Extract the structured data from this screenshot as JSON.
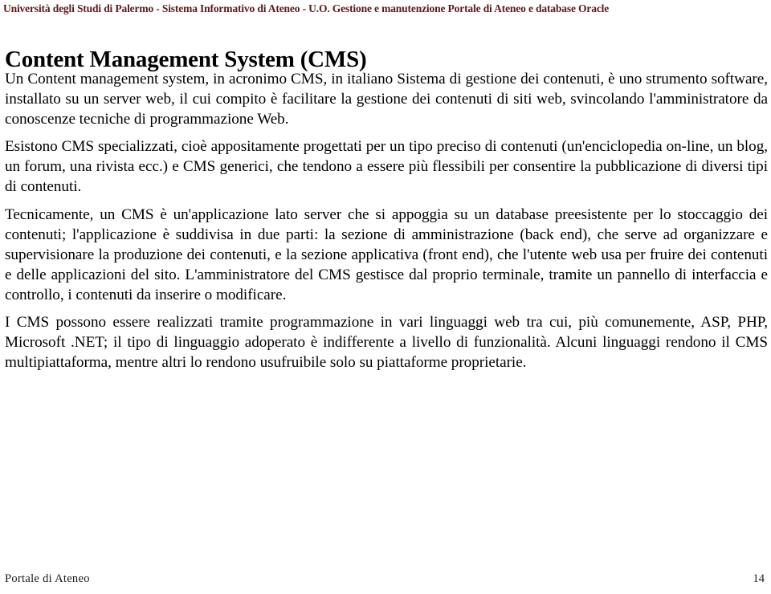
{
  "header": {
    "text": "Università degli Studi di Palermo - Sistema Informativo di Ateneo - U.O. Gestione e manutenzione Portale di Ateneo e database Oracle",
    "color": "#5c1a17"
  },
  "title": "Content Management System (CMS)",
  "body": {
    "paragraphs": [
      "Un Content management system, in acronimo CMS, in italiano Sistema di gestione dei contenuti, è uno strumento software, installato su un server web, il cui compito è facilitare la gestione dei contenuti di siti web, svincolando l'amministratore da conoscenze tecniche di programmazione Web.",
      "Esistono CMS specializzati, cioè appositamente progettati per un tipo preciso di contenuti (un'enciclopedia on-line, un blog, un forum, una rivista ecc.) e CMS generici, che tendono a essere più flessibili per consentire la pubblicazione di diversi tipi di contenuti.",
      "Tecnicamente, un CMS è un'applicazione lato server che si appoggia su un database preesistente per lo stoccaggio dei contenuti; l'applicazione è suddivisa in due parti: la sezione di amministrazione (back end), che serve ad organizzare e supervisionare la produzione dei contenuti, e la sezione applicativa (front end), che l'utente web usa per fruire dei contenuti e delle applicazioni del sito. L'amministratore del CMS gestisce dal proprio terminale, tramite un pannello di interfaccia e controllo, i contenuti da inserire o modificare.",
      "I CMS possono essere realizzati tramite programmazione in vari linguaggi web tra cui, più comunemente, ASP, PHP, Microsoft .NET; il tipo di linguaggio adoperato è indifferente a livello di funzionalità. Alcuni linguaggi rendono il CMS multipiattaforma, mentre altri lo rendono usufruibile solo su piattaforme proprietarie."
    ]
  },
  "footer": {
    "left": "Portale  di Ateneo",
    "page_number": "14"
  }
}
